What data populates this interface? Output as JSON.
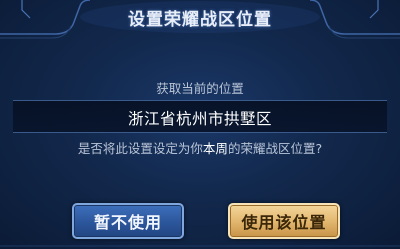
{
  "dialog": {
    "title": "设置荣耀战区位置",
    "subtitle": "获取当前的位置",
    "location": "浙江省杭州市拱墅区",
    "question_before": "是否将此设置设定为你",
    "question_highlight": "本周",
    "question_after": "的荣耀战区位置?"
  },
  "buttons": {
    "cancel_label": "暂不使用",
    "confirm_label": "使用该位置"
  },
  "colors": {
    "background": "#12284c",
    "cancel_button": "#2c569b",
    "confirm_button": "#e3b871",
    "text_muted": "#b9c4d6"
  }
}
